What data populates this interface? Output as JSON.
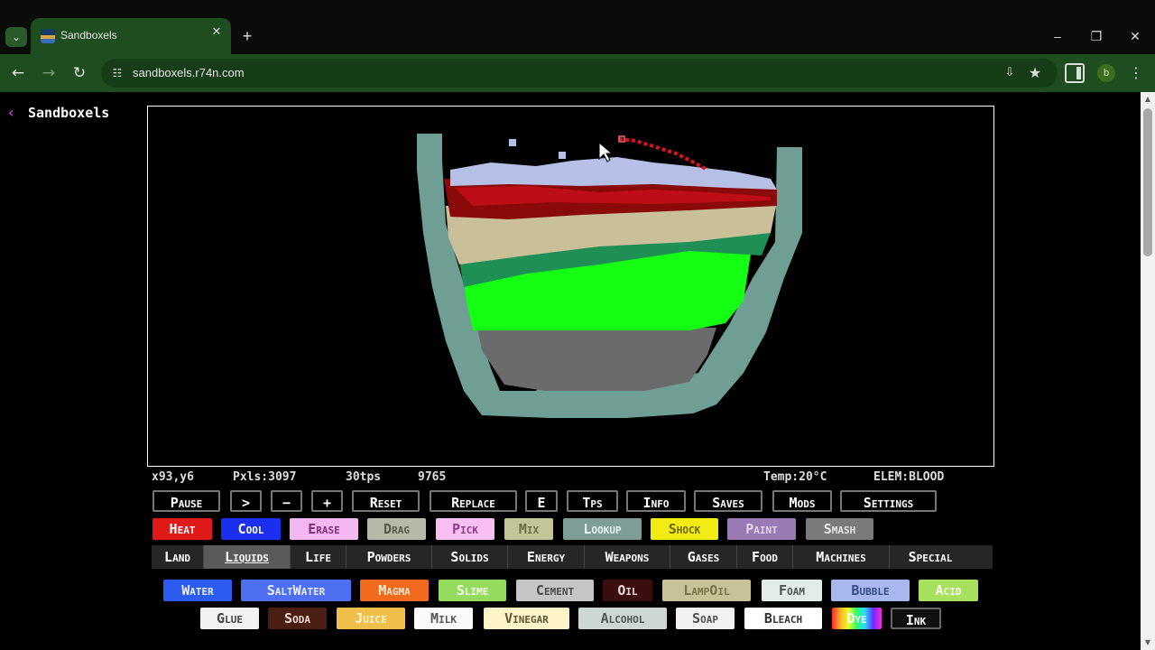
{
  "browser": {
    "tab_title": "Sandboxels",
    "url": "sandboxels.r74n.com",
    "profile_initial": "b"
  },
  "page": {
    "title": "Sandboxels"
  },
  "stats": {
    "cursor": "x93,y6",
    "pixels": "Pxls:3097",
    "tps": "30tps",
    "ticks": "9765",
    "temp": "Temp:20°C",
    "element": "ELEM:BLOOD"
  },
  "controls": [
    "Pause",
    ">",
    "−",
    "+",
    "Reset",
    "Replace",
    "E",
    "Tps",
    "Info",
    "Saves",
    "Mods",
    "Settings"
  ],
  "tools": [
    {
      "label": "Heat",
      "bg": "#e01919",
      "fg": "#ffffff"
    },
    {
      "label": "Cool",
      "bg": "#1a2ff0",
      "fg": "#ffffff"
    },
    {
      "label": "Erase",
      "bg": "#f5b7f2",
      "fg": "#7a2f7a"
    },
    {
      "label": "Drag",
      "bg": "#b6b9a6",
      "fg": "#55594a"
    },
    {
      "label": "Pick",
      "bg": "#f9bff2",
      "fg": "#8f3e88"
    },
    {
      "label": "Mix",
      "bg": "#c3c596",
      "fg": "#6a6c40"
    },
    {
      "label": "Lookup",
      "bg": "#7f9d97",
      "fg": "#e9f3f0"
    },
    {
      "label": "Shock",
      "bg": "#f2ec12",
      "fg": "#6b6500"
    },
    {
      "label": "Paint",
      "bg": "#9a7ab4",
      "fg": "#e0d4ea"
    },
    {
      "label": "Smash",
      "bg": "#7a7a7a",
      "fg": "#e6e6e6"
    }
  ],
  "categories": [
    "Land",
    "Liquids",
    "Life",
    "Powders",
    "Solids",
    "Energy",
    "Weapons",
    "Gases",
    "Food",
    "Machines",
    "Special"
  ],
  "active_category": "Liquids",
  "elements_row1": [
    {
      "label": "Water",
      "bg": "#2b5bf0",
      "fg": "#e8eeff"
    },
    {
      "label": "SaltWater",
      "bg": "#4e6ff2",
      "fg": "#e8eeff"
    },
    {
      "label": "Magma",
      "bg": "#ef6a1c",
      "fg": "#ffe7cc"
    },
    {
      "label": "Slime",
      "bg": "#95dc5e",
      "fg": "#f4ffe8"
    },
    {
      "label": "Cement",
      "bg": "#c5c5c5",
      "fg": "#4a4a4a"
    },
    {
      "label": "Oil",
      "bg": "#3a0e0e",
      "fg": "#f2d9d9"
    },
    {
      "label": "LampOil",
      "bg": "#c8c298",
      "fg": "#7a7346"
    },
    {
      "label": "Foam",
      "bg": "#e2ece9",
      "fg": "#4b5552"
    },
    {
      "label": "Bubble",
      "bg": "#a8b7ee",
      "fg": "#384a82"
    },
    {
      "label": "Acid",
      "bg": "#a7e05e",
      "fg": "#f4ffe8"
    }
  ],
  "elements_row2": [
    {
      "label": "Glue",
      "bg": "#f2f2f2",
      "fg": "#444444"
    },
    {
      "label": "Soda",
      "bg": "#4a1e12",
      "fg": "#f2dcd2"
    },
    {
      "label": "Juice",
      "bg": "#f0bf4a",
      "fg": "#fff3cf"
    },
    {
      "label": "Milk",
      "bg": "#fafafa",
      "fg": "#555555"
    },
    {
      "label": "Vinegar",
      "bg": "#fff4c8",
      "fg": "#5e5533"
    },
    {
      "label": "Alcohol",
      "bg": "#cfd6d6",
      "fg": "#4e5656"
    },
    {
      "label": "Soap",
      "bg": "#f1f1f1",
      "fg": "#505050"
    },
    {
      "label": "Bleach",
      "bg": "#ffffff",
      "fg": "#333333"
    },
    {
      "label": "Dye",
      "bg": "rainbow",
      "fg": "#ffffff"
    },
    {
      "label": "Ink",
      "bg": "#101010",
      "fg": "#ffffff"
    }
  ]
}
